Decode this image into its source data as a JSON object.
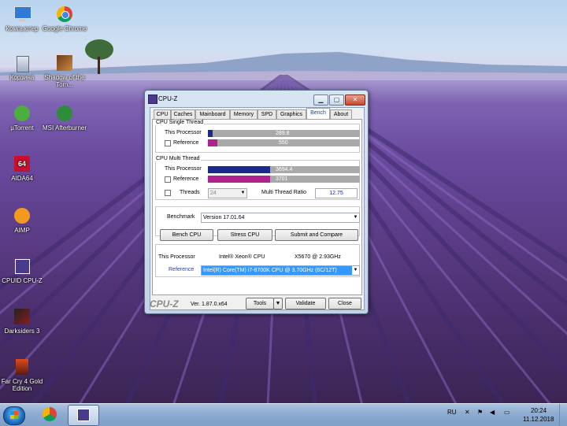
{
  "desktop": {
    "icons": [
      {
        "label": "Компьютер"
      },
      {
        "label": "Google Chrome"
      },
      {
        "label": "Корзина"
      },
      {
        "label": "Shadow of the Tom..."
      },
      {
        "label": "µTorrent"
      },
      {
        "label": "MSI Afterburner"
      },
      {
        "label": "AIDA64"
      },
      {
        "label": "AIMP"
      },
      {
        "label": "CPUID CPU-Z"
      },
      {
        "label": "Darksiders 3"
      },
      {
        "label": "Far Cry 4 Gold Edition"
      }
    ]
  },
  "window": {
    "title": "CPU-Z",
    "controls": {
      "minimize": "▁",
      "maximize": "▢",
      "close": "✕"
    },
    "tabs": [
      "CPU",
      "Caches",
      "Mainboard",
      "Memory",
      "SPD",
      "Graphics",
      "Bench",
      "About"
    ],
    "active_tab": "Bench",
    "single": {
      "title": "CPU Single Thread",
      "this_label": "This Processor",
      "this_value": "289.8",
      "this_fraction": 0.03,
      "ref_label": "Reference",
      "ref_value": "550",
      "ref_fraction": 0.06
    },
    "multi": {
      "title": "CPU Multi Thread",
      "this_label": "This Processor",
      "this_value": "3694.4",
      "this_fraction": 0.41,
      "ref_label": "Reference",
      "ref_value": "3701",
      "ref_fraction": 0.41,
      "threads_label": "Threads",
      "threads_value": "24",
      "ratio_label": "Multi Thread Ratio",
      "ratio_value": "12.75"
    },
    "benchmark": {
      "label": "Benchmark",
      "version": "Version 17.01.64",
      "bench_cpu": "Bench CPU",
      "stress_cpu": "Stress CPU",
      "submit": "Submit and Compare"
    },
    "proc": {
      "this_label": "This Processor",
      "this_name": "Intel® Xeon® CPU",
      "this_model": "X5670  @ 2.93GHz",
      "ref_label": "Reference",
      "ref_value": "Intel(R) Core(TM) i7-8700K CPU @ 3.70GHz (6C/12T)"
    },
    "footer": {
      "logo": "CPU-Z",
      "version": "Ver. 1.87.0.x64",
      "tools": "Tools",
      "validate": "Validate",
      "close": "Close"
    }
  },
  "taskbar": {
    "lang": "RU",
    "time": "20:24",
    "date": "11.12.2018"
  },
  "colors": {
    "single_this": "#1a2a8c",
    "single_ref": "#b0228c",
    "multi_this": "#1a2a8c",
    "multi_ref": "#b0228c",
    "ref_highlight": "#3399ff"
  }
}
